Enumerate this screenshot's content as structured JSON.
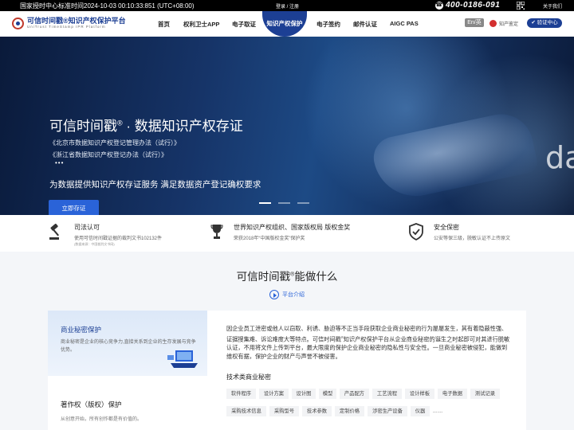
{
  "topbar": {
    "time": "国家授时中心标准时间2024-10-03 00:10:33:851 (UTC+08:00)",
    "login": "登录 / 注册",
    "phone": "400-0186-091",
    "about": "关于我们"
  },
  "header": {
    "logo_title": "可信时间戳®知识产权保护平台",
    "logo_sub": "UniTrust  TimeStamp  IPR  Platform",
    "nav": [
      "首页",
      "权利卫士APP",
      "电子取证",
      "知识产权保护",
      "电子签约",
      "邮件认证",
      "AIGC PAS"
    ],
    "lang": "En/英",
    "ip_check": "知产鉴定",
    "verify": "验证中心"
  },
  "hero": {
    "title": "可信时间戳",
    "title_reg": "®",
    "title_rest": " · 数据知识产权存证",
    "laws": [
      "《北京市数据知识产权登记管理办法（试行）》",
      "《浙江省数据知识产权登记办法（试行）》"
    ],
    "dots": "•••",
    "slogan": "为数据提供知识产权存证服务  满足数据资产登记确权要求",
    "cta": "立即存证",
    "overlay_text": "da",
    "slides": 3,
    "active_slide": 1
  },
  "features": [
    {
      "title": "司法认可",
      "desc": "使用可信时间戳证据的裁判文书102132件",
      "note": "(数据来源：中国裁判文书网)"
    },
    {
      "title": "世界知识产权组织、国家版权局 版权金奖",
      "desc": "荣获2018年“中国版权金奖”保护奖",
      "note": ""
    },
    {
      "title": "安全保密",
      "desc": "公安等保三级，脱敏认证不上传原文",
      "note": ""
    }
  ],
  "section": {
    "title": "可信时间戳",
    "title_reg": "®",
    "title_rest": "能做什么",
    "intro": "平台介绍"
  },
  "card": {
    "left": [
      {
        "title": "商业秘密保护",
        "desc": "商业秘密是企业的核心竞争力,直接关系到企业的生存发展与竞争优势。"
      },
      {
        "title": "著作权（版权）保护",
        "desc": "从创意开始，所有创作都是有价值的。"
      }
    ],
    "para_a": "因企业员工泄密或他人以窃取、利诱、胁迫等不正当手段获取企业商业秘密的行为屡屡发生，其有着隐蔽性强、证据搜集难、诉讼难度大等特点。可信时间戳",
    "para_reg": "®",
    "para_b": "知识产权保护平台从企业商业秘密的诞生之时起即可对其进行脱敏认证，不用将文件上传到平台，最大限度的保护企业商业秘密的隐私性与安全性。一旦商业秘密被侵犯，能做到维权有据，保护企业的财产与声誉不被侵害。",
    "sub": "技术类商业秘密",
    "tags_row1": [
      "软件程序",
      "设计方案",
      "设计图",
      "模型",
      "产品配方",
      "工艺流程",
      "设计样板",
      "电子数据",
      "测试记录"
    ],
    "tags_row2": [
      "采购技术信息",
      "采购型号",
      "技术参数",
      "定制价格",
      "涉密生产设备",
      "仪器",
      "……"
    ]
  }
}
